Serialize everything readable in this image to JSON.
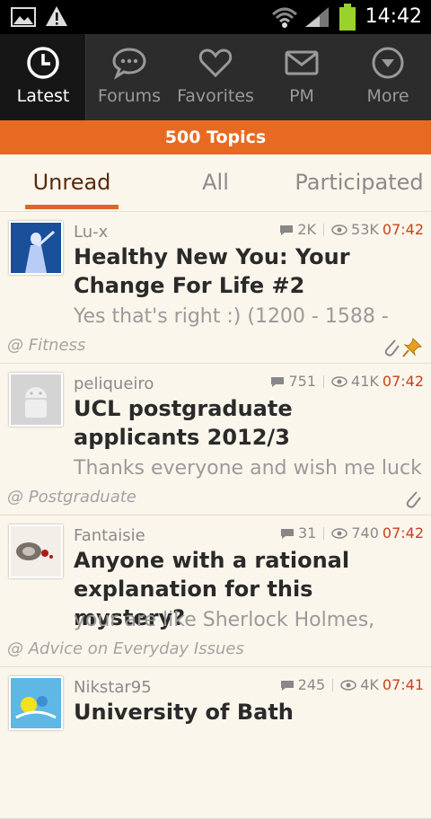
{
  "status": {
    "time": "14:42"
  },
  "nav": [
    {
      "label": "Latest",
      "icon": "clock-icon"
    },
    {
      "label": "Forums",
      "icon": "speech-bubble-icon"
    },
    {
      "label": "Favorites",
      "icon": "heart-icon"
    },
    {
      "label": "PM",
      "icon": "mail-icon"
    },
    {
      "label": "More",
      "icon": "chevron-down-circle-icon"
    }
  ],
  "banner": "500 Topics",
  "tabs": [
    "Unread",
    "All",
    "Participated"
  ],
  "topics": [
    {
      "author": "Lu-x",
      "replies": "2K",
      "views": "53K",
      "time": "07:42",
      "title": "Healthy New You: Your Change For Life #2",
      "snippet": "Yes that's right :) (1200 - 1588 -",
      "forum": "@ Fitness",
      "attachment": true,
      "pinned": true
    },
    {
      "author": "peliqueiro",
      "replies": "751",
      "views": "41K",
      "time": "07:42",
      "title": "UCL postgraduate applicants 2012/3",
      "snippet": "Thanks everyone and wish me luck!",
      "forum": "@ Postgraduate",
      "attachment": true,
      "pinned": false
    },
    {
      "author": "Fantaisie",
      "replies": "31",
      "views": "740",
      "time": "07:42",
      "title": "Anyone with a rational explanation for this mystery?",
      "snippet": "your are like Sherlock Holmes,",
      "forum": "@ Advice on Everyday Issues",
      "attachment": false,
      "pinned": false
    },
    {
      "author": "Nikstar95",
      "replies": "245",
      "views": "4K",
      "time": "07:41",
      "title": "University of Bath",
      "snippet": "",
      "forum": "",
      "attachment": false,
      "pinned": false
    }
  ],
  "colors": {
    "accent": "#e86a22",
    "time": "#c3441a"
  }
}
